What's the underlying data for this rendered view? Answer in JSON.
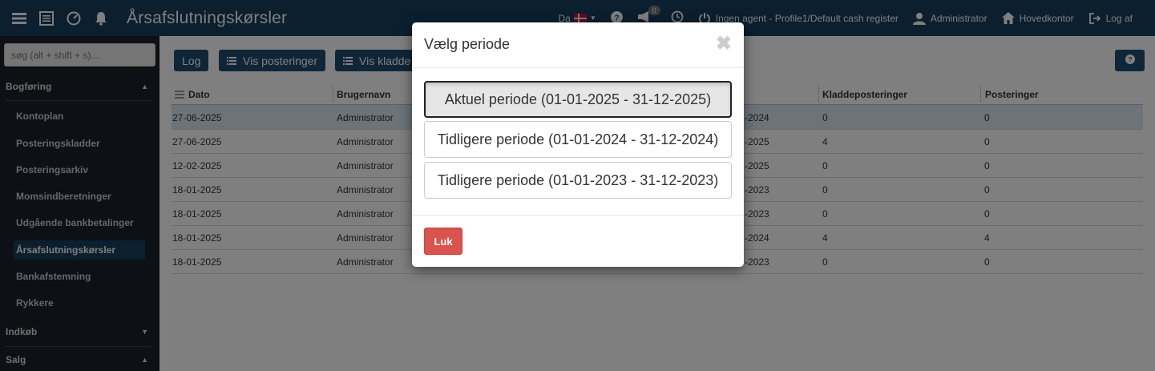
{
  "topbar": {
    "title": "Årsafslutningskørsler",
    "language": "Da",
    "notification_count": "0",
    "agent_status": "Ingen agent - Profile1/Default cash register",
    "user": "Administrator",
    "office": "Hovedkontor",
    "logout": "Log af"
  },
  "sidebar": {
    "search_placeholder": "søg (alt + shift + s)...",
    "section_bogforing": "Bogføring",
    "items": [
      "Kontoplan",
      "Posteringskladder",
      "Posteringsarkiv",
      "Momsindberetninger",
      "Udgående bankbetalinger",
      "Årsafslutningskørsler",
      "Bankafstemning",
      "Rykkere"
    ],
    "section_indkob": "Indkøb",
    "section_salg": "Salg"
  },
  "toolbar": {
    "log_label": "Log",
    "vis_posteringer_label": "Vis posteringer",
    "vis_kladder_label": "Vis kladde"
  },
  "table": {
    "headers": {
      "dato": "Dato",
      "brugernavn": "Brugernavn",
      "kladdeposteringer": "Kladdeposteringer",
      "posteringer": "Posteringer"
    },
    "rows": [
      {
        "dato": "27-06-2025",
        "bruger": "Administrator",
        "periode": "-2024",
        "kladde": "0",
        "post": "0"
      },
      {
        "dato": "27-06-2025",
        "bruger": "Administrator",
        "periode": "-2025",
        "kladde": "4",
        "post": "0"
      },
      {
        "dato": "12-02-2025",
        "bruger": "Administrator",
        "periode": "-2025",
        "kladde": "0",
        "post": "0"
      },
      {
        "dato": "18-01-2025",
        "bruger": "Administrator",
        "periode": "-2023",
        "kladde": "0",
        "post": "0"
      },
      {
        "dato": "18-01-2025",
        "bruger": "Administrator",
        "periode": "-2023",
        "kladde": "0",
        "post": "0"
      },
      {
        "dato": "18-01-2025",
        "bruger": "Administrator",
        "periode": "-2024",
        "kladde": "4",
        "post": "4"
      },
      {
        "dato": "18-01-2025",
        "bruger": "Administrator",
        "periode": "-2023",
        "kladde": "0",
        "post": "0"
      }
    ]
  },
  "modal": {
    "title": "Vælg periode",
    "close": "✖",
    "periods": [
      "Aktuel periode (01-01-2025 - 31-12-2025)",
      "Tidligere periode (01-01-2024 - 31-12-2024)",
      "Tidligere periode (01-01-2023 - 31-12-2023)"
    ],
    "close_button": "Luk"
  },
  "colors": {
    "navbar": "#163e5c",
    "sidebar": "#1a2129",
    "primary_button": "#1e4d73",
    "danger_button": "#d9534f",
    "selected_row": "#d9e6f2"
  },
  "icons": [
    "menu-icon",
    "list-icon",
    "dashboard-icon",
    "bell-icon",
    "help-icon",
    "megaphone-icon",
    "clock-icon",
    "power-icon",
    "user-icon",
    "home-icon",
    "logout-icon",
    "list-lines-icon",
    "close-icon"
  ]
}
